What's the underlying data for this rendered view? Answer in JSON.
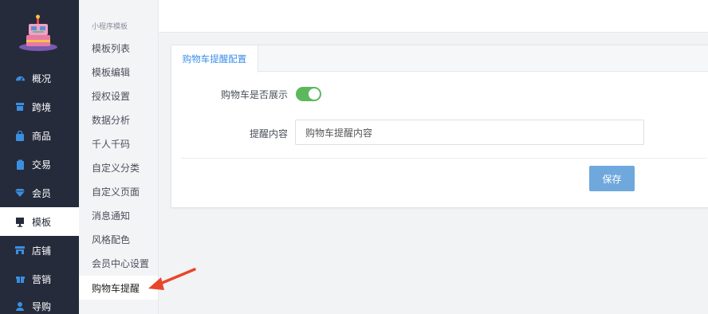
{
  "leftnav": {
    "items": [
      {
        "label": "概况",
        "icon": "gauge-icon"
      },
      {
        "label": "跨境",
        "icon": "archive-icon"
      },
      {
        "label": "商品",
        "icon": "bag-icon"
      },
      {
        "label": "交易",
        "icon": "clipboard-icon"
      },
      {
        "label": "会员",
        "icon": "diamond-icon"
      },
      {
        "label": "模板",
        "icon": "monitor-icon"
      },
      {
        "label": "店铺",
        "icon": "store-icon"
      },
      {
        "label": "营销",
        "icon": "gift-icon"
      },
      {
        "label": "导购",
        "icon": "user-icon"
      }
    ],
    "active_index": 5
  },
  "subnav": {
    "group": "小程序模板",
    "items": [
      {
        "label": "模板列表"
      },
      {
        "label": "模板编辑"
      },
      {
        "label": "授权设置"
      },
      {
        "label": "数据分析"
      },
      {
        "label": "千人千码"
      },
      {
        "label": "自定义分类"
      },
      {
        "label": "自定义页面"
      },
      {
        "label": "消息通知"
      },
      {
        "label": "风格配色"
      },
      {
        "label": "会员中心设置"
      },
      {
        "label": "购物车提醒"
      }
    ],
    "active_index": 10
  },
  "panel": {
    "tab": "购物车提醒配置",
    "show_label": "购物车是否展示",
    "show_enabled": true,
    "content_label": "提醒内容",
    "content_value": "购物车提醒内容",
    "save_label": "保存"
  },
  "colors": {
    "nav_bg": "#252b3b",
    "accent_blue": "#3a8ee6",
    "switch_on": "#5cb85c",
    "save_btn": "#6fa8dc",
    "arrow": "#e8462a"
  }
}
